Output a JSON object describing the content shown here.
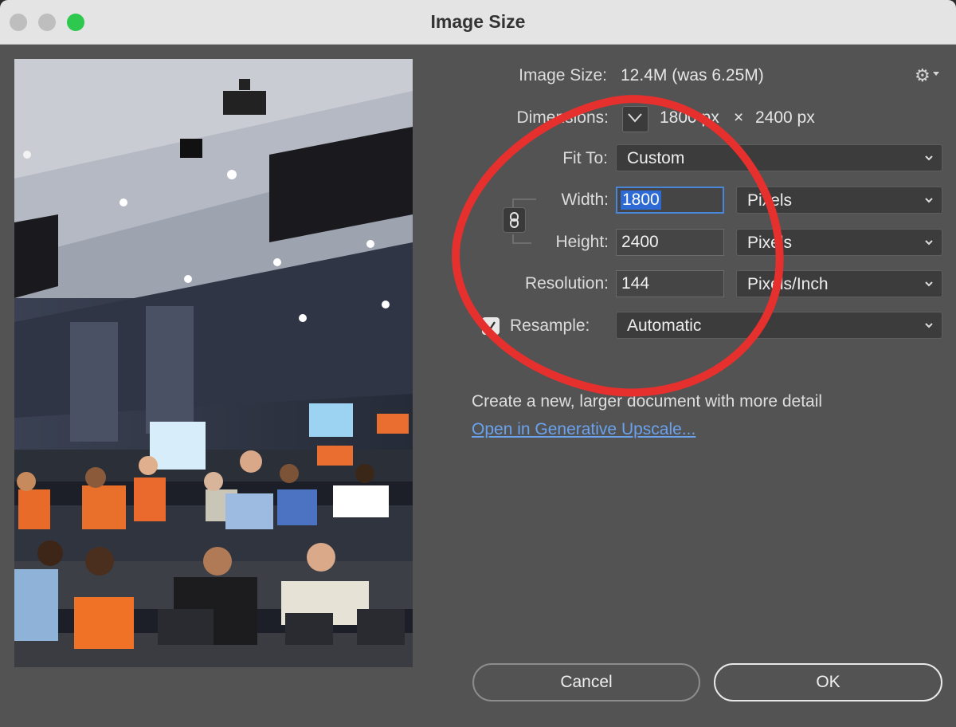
{
  "window": {
    "title": "Image Size"
  },
  "info": {
    "image_size_label": "Image Size:",
    "image_size_value": "12.4M (was 6.25M)",
    "dimensions_label": "Dimensions:",
    "dimensions_width": "1800 px",
    "dimensions_x": "×",
    "dimensions_height": "2400 px"
  },
  "fit_to": {
    "label": "Fit To:",
    "value": "Custom"
  },
  "width": {
    "label": "Width:",
    "value": "1800",
    "unit": "Pixels"
  },
  "height": {
    "label": "Height:",
    "value": "2400",
    "unit": "Pixels"
  },
  "resolution": {
    "label": "Resolution:",
    "value": "144",
    "unit": "Pixels/Inch"
  },
  "resample": {
    "label": "Resample:",
    "checked": true,
    "value": "Automatic"
  },
  "upscale": {
    "description": "Create a new, larger document with more detail",
    "link": "Open in Generative Upscale..."
  },
  "buttons": {
    "cancel": "Cancel",
    "ok": "OK"
  },
  "icons": {
    "settings": "gear-icon",
    "dimensions_toggle": "chevron-down-icon",
    "constrain": "link-chain-icon",
    "annotation": "red-circle-annotation"
  },
  "colors": {
    "dialog_bg": "#535353",
    "accent": "#2d6ad3",
    "link": "#6aa2ee",
    "annotation": "#e5302e"
  }
}
